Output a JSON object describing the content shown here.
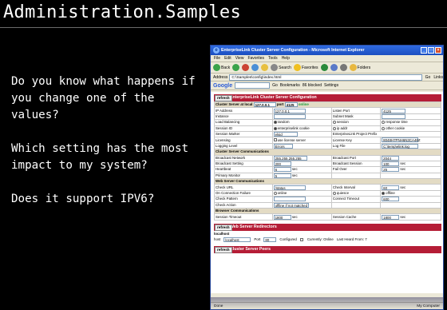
{
  "slide": {
    "title": "Administration.Samples",
    "questions": [
      "Do you know what happens if you change one of the values?",
      "Which setting has the most impact to my system?",
      "Does it support IPV6?"
    ]
  },
  "browser": {
    "window_title": "EnterpriseLink Cluster Server Configuration - Microsoft Internet Explorer",
    "menu": [
      "File",
      "Edit",
      "View",
      "Favorites",
      "Tools",
      "Help"
    ],
    "toolbar": {
      "back": "Back",
      "search": "Search",
      "favorites": "Favorites",
      "folders": "Folders"
    },
    "address_label": "Address",
    "address_value": "C:\\Samples\\config\\index.html",
    "go": "Go",
    "links": "Links",
    "google_label": "Google",
    "google_go": "Go",
    "bookmarks": "Bookmarks",
    "blocked": "86 blocked",
    "settings": "Settings",
    "status_left": "Done",
    "status_right": "My Computer"
  },
  "config": {
    "refresh": "refresh",
    "cluster_head": "EnterpriseLink Cluster Server Configuration",
    "server_at_local": "Cluster Server at local",
    "ip_value": "127.0.0.1",
    "port_label": "port",
    "port_value": "4125",
    "status": "online",
    "rows": [
      {
        "k1": "IP Address",
        "v1": "127.0.0.1",
        "k2": "Listen Port",
        "v2": "4125"
      },
      {
        "k1": "Instance",
        "v1": "",
        "k2": "Subnet Mask",
        "v2": ""
      },
      {
        "k1": "Load Balancing",
        "v1": "random",
        "k2": "session",
        "v2": "response time"
      },
      {
        "k1": "Session ID",
        "v1": "enterpriselink cookie",
        "k2": "ip addr",
        "v2": "other cookie"
      },
      {
        "k1": "Session Marker",
        "v1": "elsid",
        "k2": "EnterpriseLink Project Prefix",
        "v2": ""
      },
      {
        "k1": "Licensing",
        "v1": "use license server",
        "k2": "License Key",
        "v2": "8048H7PNH6N3CA46Z"
      },
      {
        "k1": "Logging Level",
        "v1": "Errors",
        "k2": "Log File",
        "v2": "C:\\temp\\elink.log"
      }
    ],
    "comm_head": "Cluster Server Communications",
    "comm_rows": [
      {
        "k1": "Broadcast Network",
        "v1": "255.255.255.255",
        "k2": "Broadcast Port",
        "v2": "2044"
      },
      {
        "k1": "Broadcast Setting",
        "v1": "200",
        "k2": "Broadcast Session",
        "v2": "100",
        "u2": "sec"
      },
      {
        "k1": "Heartbeat",
        "v1": "6",
        "u1": "sec",
        "k2": "Fail Over",
        "v2": "25",
        "u2": "sec"
      },
      {
        "k1": "Primary Monitor",
        "v1": "5",
        "u1": "sec",
        "k2": "",
        "v2": ""
      }
    ],
    "web_head": "Web Server Communications",
    "web_rows": [
      {
        "k1": "Check URL",
        "v1": "/status",
        "k2": "Check Interval",
        "v2": "60",
        "u2": "sec"
      },
      {
        "k1": "On Connection Failure",
        "v1": "online",
        "k2": "quiesce",
        "v2": "offline"
      },
      {
        "k1": "Check Pattern",
        "v1": "",
        "k2": "Connect Timeout",
        "v2": "600"
      },
      {
        "k1": "Check Action",
        "v1": "offline if not matched",
        "k2": "",
        "v2": ""
      }
    ],
    "browser_head": "Browser Communications",
    "browser_rows": [
      {
        "k1": "Session Timeout",
        "v1": "1800",
        "u1": "sec",
        "k2": "Session Cache",
        "v2": "1800",
        "u2": "sec"
      }
    ],
    "redirector_head": "Web Server Redirectors",
    "redirector": {
      "location": "localhost",
      "host_label": "host",
      "host_value": "localhost",
      "port_label": "Port",
      "port_value": "80",
      "configured": "Configured",
      "currently": "Currently: Online",
      "last_heard": "Last Heard From: 7"
    },
    "peers_head": "Cluster Server Peers"
  }
}
